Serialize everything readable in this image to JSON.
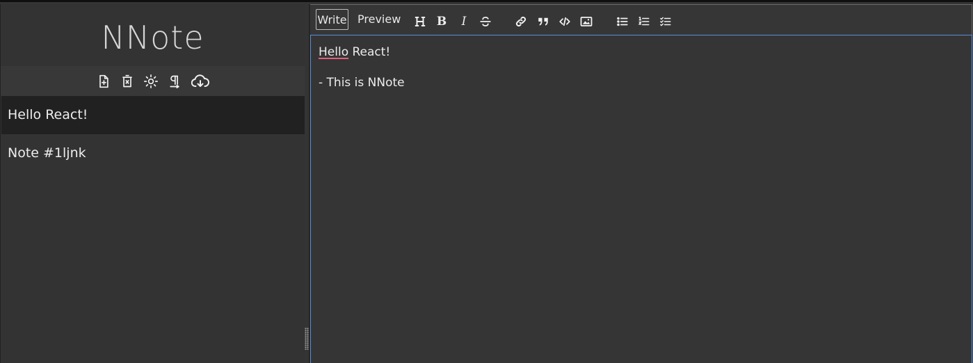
{
  "app": {
    "brand": "NNote"
  },
  "sidebar": {
    "toolbar": [
      {
        "icon": "new-note-icon",
        "label": "new note"
      },
      {
        "icon": "delete-note-icon",
        "label": "delete note"
      },
      {
        "icon": "theme-toggle-icon",
        "label": "toggle theme"
      },
      {
        "icon": "paragraph-icon",
        "label": "paragraph"
      },
      {
        "icon": "cloud-download-icon",
        "label": "download"
      }
    ],
    "notes": [
      {
        "title": "Hello React!",
        "active": true
      },
      {
        "title": "Note #1ljnk",
        "active": false
      }
    ]
  },
  "editor": {
    "tabs": {
      "write": "Write",
      "preview": "Preview"
    },
    "active_tab": "Write",
    "toolbar_icons": [
      "header-icon",
      "bold-icon",
      "italic-icon",
      "strikethrough-icon",
      "link-icon",
      "quote-icon",
      "code-icon",
      "image-icon",
      "unordered-list-icon",
      "ordered-list-icon",
      "checklist-icon"
    ],
    "content": {
      "line1_word": "Hello",
      "line1_rest": " React!",
      "line3": "- This is NNote"
    }
  },
  "colors": {
    "background": "#343434",
    "active_note": "#212121",
    "focus_border": "#5a8fd8",
    "spellcheck": "#e0607a"
  }
}
